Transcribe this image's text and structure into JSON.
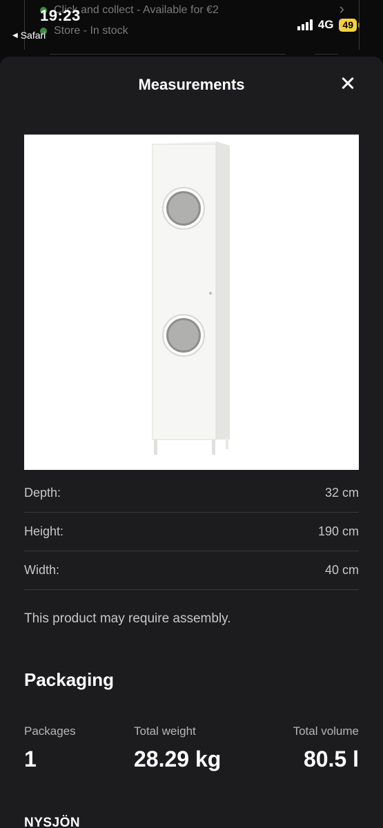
{
  "background": {
    "row1": "Click and collect - Available for €2",
    "row2": "Store - In stock"
  },
  "status_bar": {
    "time": "19:23",
    "back_label": "Safari",
    "network": "4G",
    "battery": "49"
  },
  "sheet": {
    "title": "Measurements"
  },
  "dimensions": [
    {
      "label": "Depth:",
      "value": "32 cm"
    },
    {
      "label": "Height:",
      "value": "190 cm"
    },
    {
      "label": "Width:",
      "value": "40 cm"
    }
  ],
  "assembly_note": "This product may require assembly.",
  "packaging": {
    "title": "Packaging",
    "packages_label": "Packages",
    "packages_value": "1",
    "weight_label": "Total weight",
    "weight_value": "28.29 kg",
    "volume_label": "Total volume",
    "volume_value": "80.5 l"
  },
  "next_section": "NYSJÖN",
  "colors": {
    "sheet_bg": "#1c1c1e",
    "battery": "#f3d13e",
    "stock_dot": "#3c8a3c"
  }
}
